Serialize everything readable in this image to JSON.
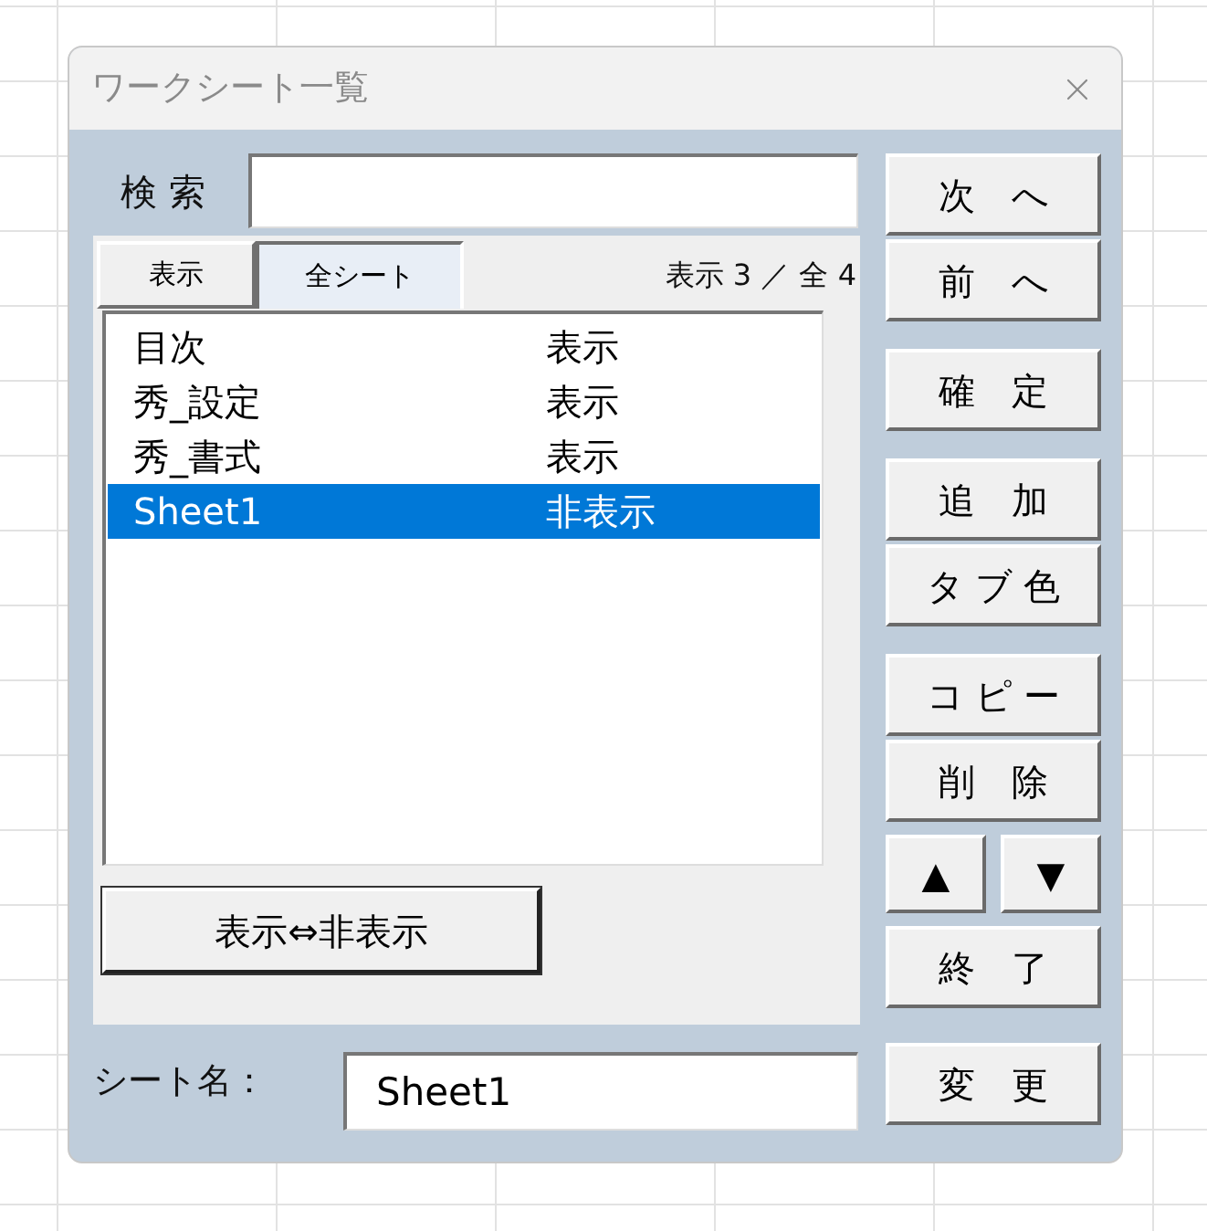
{
  "window": {
    "title": "ワークシート一覧"
  },
  "search": {
    "label": "検 索"
  },
  "tabs": [
    {
      "label": "表示",
      "selected": false
    },
    {
      "label": "全シート",
      "selected": true
    }
  ],
  "count": "表示 3 ／ 全 4",
  "sheets": [
    {
      "name": "目次",
      "status": "表示",
      "selected": false
    },
    {
      "name": "秀_設定",
      "status": "表示",
      "selected": false
    },
    {
      "name": "秀_書式",
      "status": "表示",
      "selected": false
    },
    {
      "name": "Sheet1",
      "status": "非表示",
      "selected": true
    }
  ],
  "toggle_button": "表示⇔非表示",
  "sheet_name": {
    "label": "シート名：",
    "value": "Sheet1"
  },
  "button_groups": [
    [
      {
        "kind": "single",
        "label": "次　へ"
      },
      {
        "kind": "single",
        "label": "前　へ"
      }
    ],
    [
      {
        "kind": "single",
        "label": "確　定"
      }
    ],
    [
      {
        "kind": "single",
        "label": "追　加"
      },
      {
        "kind": "single",
        "label": "タ ブ 色"
      }
    ],
    [
      {
        "kind": "single",
        "label": "コ ピ ー"
      },
      {
        "kind": "single",
        "label": "削　除"
      },
      {
        "kind": "pair",
        "labels": [
          "▲",
          "▼"
        ]
      },
      {
        "kind": "single",
        "label": "終　了"
      }
    ],
    [
      {
        "kind": "single",
        "label": "変　更"
      }
    ]
  ]
}
